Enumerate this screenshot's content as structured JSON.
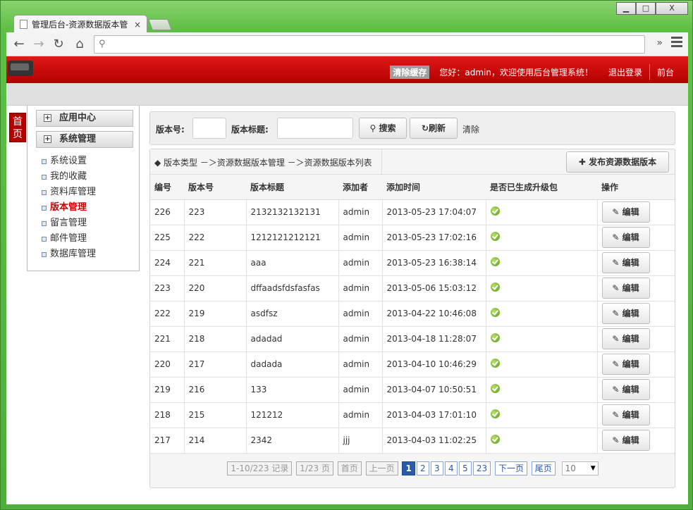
{
  "browser": {
    "tab_title": "管理后台-资源数据版本管",
    "tab_close": "×",
    "back": "←",
    "forward": "→",
    "reload": "↻",
    "home": "⌂",
    "search_glyph": "🔍",
    "chevron": "»",
    "win_min": "▁",
    "win_max": "□",
    "win_close": "X"
  },
  "header": {
    "clear_cache": "清除缓存",
    "welcome": "您好：admin，欢迎使用后台管理系统！",
    "logout": "退出登录",
    "frontend": "前台"
  },
  "home_tab": "首页",
  "sidebar": {
    "group1": "应用中心",
    "group2": "系统管理",
    "items": [
      "系统设置",
      "我的收藏",
      "资料库管理",
      "版本管理",
      "留言管理",
      "邮件管理",
      "数据库管理"
    ],
    "active_index": 3
  },
  "search": {
    "version_label": "版本号:",
    "title_label": "版本标题:",
    "search_btn": "搜索",
    "refresh_btn": "刷新",
    "clear": "清除"
  },
  "breadcrumb": "◆ 版本类型 －＞资源数据版本管理 －＞资源数据版本列表",
  "publish_btn": "发布资源数据版本",
  "table": {
    "headers": [
      "编号",
      "版本号",
      "版本标题",
      "添加者",
      "添加时间",
      "是否已生成升级包",
      "操作"
    ],
    "edit_label": "编辑",
    "rows": [
      [
        "226",
        "223",
        "2132132132131",
        "admin",
        "2013-05-23 17:04:07"
      ],
      [
        "225",
        "222",
        "1212121212121",
        "admin",
        "2013-05-23 17:02:16"
      ],
      [
        "224",
        "221",
        "aaa",
        "admin",
        "2013-05-23 16:38:14"
      ],
      [
        "223",
        "220",
        "dffaadsfdsfasfas",
        "admin",
        "2013-05-06 15:03:12"
      ],
      [
        "222",
        "219",
        "asdfsz",
        "admin",
        "2013-04-22 10:46:08"
      ],
      [
        "221",
        "218",
        "adadad",
        "admin",
        "2013-04-18 11:28:07"
      ],
      [
        "220",
        "217",
        "dadada",
        "admin",
        "2013-04-10 10:46:29"
      ],
      [
        "219",
        "216",
        "133",
        "admin",
        "2013-04-07 10:50:51"
      ],
      [
        "218",
        "215",
        "121212",
        "admin",
        "2013-04-03 17:01:10"
      ],
      [
        "217",
        "214",
        "2342",
        "jjj",
        "2013-04-03 11:02:25"
      ]
    ]
  },
  "pager": {
    "records": "1-10/223 记录",
    "pages": "1/23 页",
    "first": "首页",
    "prev": "上一页",
    "page_numbers": [
      "1",
      "2",
      "3",
      "4",
      "5",
      "23"
    ],
    "current": "1",
    "next": "下一页",
    "last": "尾页",
    "per_page": "10"
  }
}
